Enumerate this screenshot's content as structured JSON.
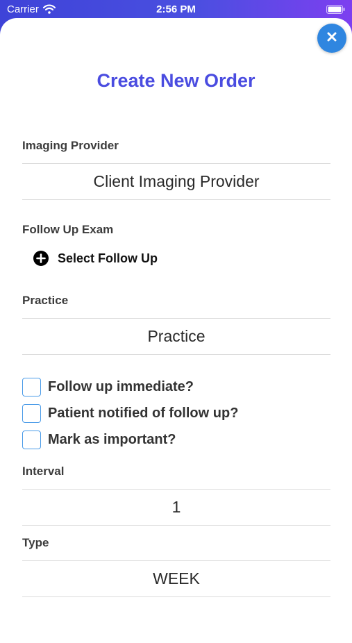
{
  "status_bar": {
    "carrier": "Carrier",
    "time": "2:56 PM"
  },
  "header": {
    "title": "Create New Order"
  },
  "form": {
    "imaging_provider": {
      "label": "Imaging Provider",
      "value": "Client Imaging Provider"
    },
    "follow_up_exam": {
      "label": "Follow Up Exam",
      "action": "Select Follow Up"
    },
    "practice": {
      "label": "Practice",
      "value": "Practice"
    },
    "checkboxes": [
      {
        "label": "Follow up immediate?",
        "checked": false
      },
      {
        "label": "Patient notified of follow up?",
        "checked": false
      },
      {
        "label": "Mark as important?",
        "checked": false
      }
    ],
    "interval": {
      "label": "Interval",
      "value": "1"
    },
    "type": {
      "label": "Type",
      "value": "WEEK"
    }
  },
  "colors": {
    "accent": "#4a4ce0",
    "close_button": "#2f86e0",
    "checkbox_border": "#4a9be8"
  },
  "icons": {
    "close": "close-icon",
    "add": "plus-circle-icon",
    "wifi": "wifi-icon",
    "battery": "battery-icon"
  }
}
